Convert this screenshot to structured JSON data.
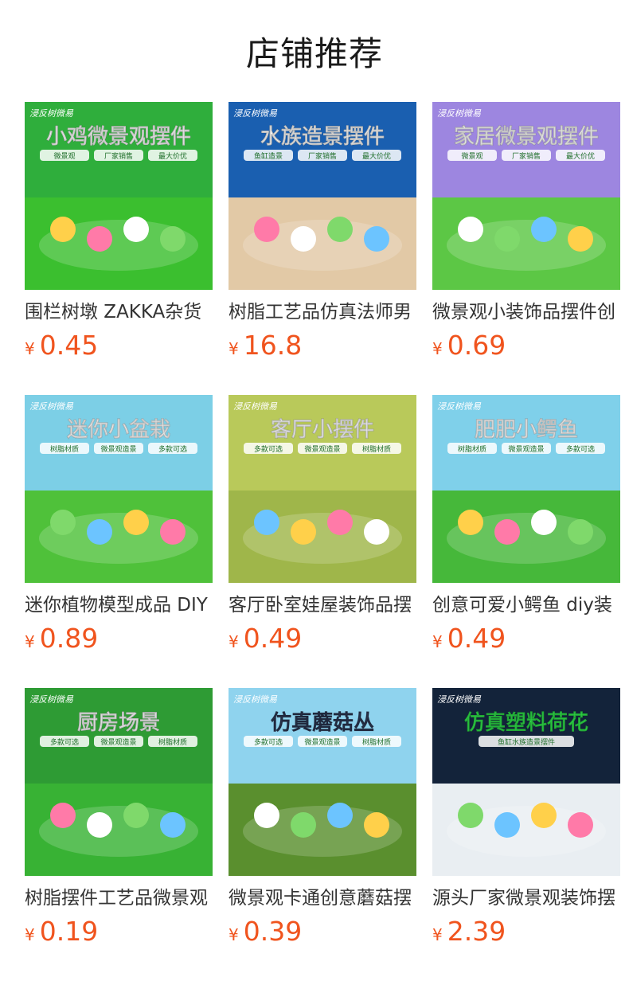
{
  "header": {
    "title": "店铺推荐"
  },
  "products": [
    {
      "name": "围栏树墩 ZAKKA杂货",
      "currency": "¥",
      "price": "0.45",
      "banner": "小鸡微景观摆件",
      "tags": [
        "微景观",
        "厂家销售",
        "最大价优"
      ],
      "brand": "浸反树微易",
      "colors": {
        "sky": "#2fae3c",
        "ground": "#3bbf2f",
        "bannerText": "#ffffff"
      }
    },
    {
      "name": "树脂工艺品仿真法师男",
      "currency": "¥",
      "price": "16.8",
      "banner": "水族造景摆件",
      "tags": [
        "鱼缸造景",
        "厂家销售",
        "最大价优"
      ],
      "brand": "浸反树微易",
      "colors": {
        "sky": "#1a5fb0",
        "ground": "#e2c9a6",
        "bannerText": "#ffffff"
      }
    },
    {
      "name": "微景观小装饰品摆件创",
      "currency": "¥",
      "price": "0.69",
      "banner": "家居微景观摆件",
      "tags": [
        "微景观",
        "厂家销售",
        "最大价优"
      ],
      "brand": "浸反树微易",
      "colors": {
        "sky": "#9d86e0",
        "ground": "#5cc745",
        "bannerText": "#ffffff"
      }
    },
    {
      "name": "迷你植物模型成品 DIY",
      "currency": "¥",
      "price": "0.89",
      "banner": "迷你小盆栽",
      "tags": [
        "树脂材质",
        "微景观造景",
        "多款可选"
      ],
      "brand": "浸反树微易",
      "colors": {
        "sky": "#7ccfe6",
        "ground": "#4fc13a",
        "bannerText": "#ffffff"
      }
    },
    {
      "name": "客厅卧室娃屋装饰品摆",
      "currency": "¥",
      "price": "0.49",
      "banner": "客厅小摆件",
      "tags": [
        "多款可选",
        "微景观造景",
        "树脂材质"
      ],
      "brand": "浸反树微易",
      "colors": {
        "sky": "#b9c95a",
        "ground": "#9fb64a",
        "bannerText": "#ffffff"
      }
    },
    {
      "name": "创意可爱小鳄鱼 diy装",
      "currency": "¥",
      "price": "0.49",
      "banner": "肥肥小鳄鱼",
      "tags": [
        "树脂材质",
        "微景观造景",
        "多款可选"
      ],
      "brand": "浸反树微易",
      "colors": {
        "sky": "#7fd0ea",
        "ground": "#46b83a",
        "bannerText": "#ffffff"
      }
    },
    {
      "name": "树脂摆件工艺品微景观",
      "currency": "¥",
      "price": "0.19",
      "banner": "厨房场景",
      "tags": [
        "多款可选",
        "微景观造景",
        "树脂材质"
      ],
      "brand": "浸反树微易",
      "colors": {
        "sky": "#2e9b34",
        "ground": "#38b234",
        "bannerText": "#ffffff"
      }
    },
    {
      "name": "微景观卡通创意蘑菇摆",
      "currency": "¥",
      "price": "0.39",
      "banner": "仿真蘑菇丛",
      "tags": [
        "多款可选",
        "微景观造景",
        "树脂材质"
      ],
      "brand": "浸反树微易",
      "colors": {
        "sky": "#8fd3ee",
        "ground": "#5a8f2e",
        "bannerText": "#2a3550"
      }
    },
    {
      "name": "源头厂家微景观装饰摆",
      "currency": "¥",
      "price": "2.39",
      "banner": "仿真塑料荷花",
      "tags": [
        "鱼缸水族造景摆件"
      ],
      "brand": "浸反树微易",
      "colors": {
        "sky": "#13233a",
        "ground": "#e9eef2",
        "bannerText": "#2fe04a"
      }
    }
  ]
}
